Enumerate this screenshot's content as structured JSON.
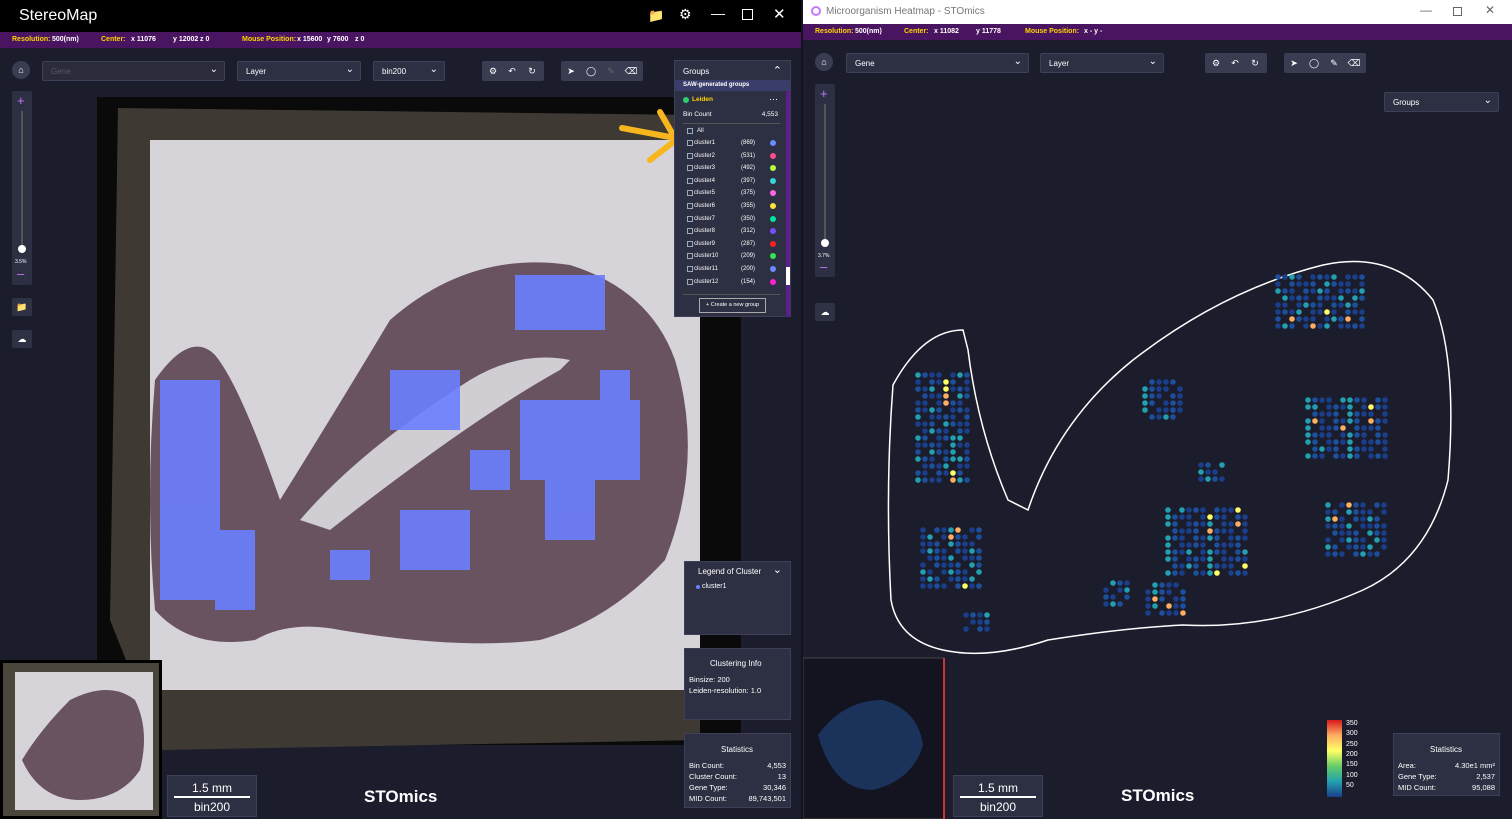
{
  "left": {
    "title": "StereoMap",
    "info": {
      "res_label": "Resolution:",
      "res_val": "500(nm)",
      "center_label": "Center:",
      "cx": "x  11076",
      "cy": "y  12002",
      "cz": "z  0",
      "mouse_label": "Mouse Position:",
      "mx": "x  15600",
      "my": "y  7600",
      "mz": "z  0"
    },
    "gene_placeholder": "Gene",
    "layer": "Layer",
    "bin": "bin200",
    "zoom": "3.5%",
    "groups": {
      "title": "Groups",
      "sub": "SAW-generated groups",
      "leiden": "Leiden",
      "bincount_label": "Bin Count",
      "bincount": "4,553",
      "all": "All",
      "create": "+  Create a new group",
      "clusters": [
        {
          "n": "cluster1",
          "c": "(869)",
          "col": "#6b8cff"
        },
        {
          "n": "cluster2",
          "c": "(531)",
          "col": "#ff4d8a"
        },
        {
          "n": "cluster3",
          "c": "(492)",
          "col": "#b4ff3a"
        },
        {
          "n": "cluster4",
          "c": "(397)",
          "col": "#33d6d6"
        },
        {
          "n": "cluster5",
          "c": "(375)",
          "col": "#ff66e0"
        },
        {
          "n": "cluster6",
          "c": "(355)",
          "col": "#ffe23a"
        },
        {
          "n": "cluster7",
          "c": "(350)",
          "col": "#00e6a0"
        },
        {
          "n": "cluster8",
          "c": "(312)",
          "col": "#7a4dff"
        },
        {
          "n": "cluster9",
          "c": "(287)",
          "col": "#ff2222"
        },
        {
          "n": "cluster10",
          "c": "(209)",
          "col": "#33e64d"
        },
        {
          "n": "cluster11",
          "c": "(200)",
          "col": "#6b8cff"
        },
        {
          "n": "cluster12",
          "c": "(154)",
          "col": "#ff22cc"
        }
      ]
    },
    "legend": {
      "title": "Legend of Cluster",
      "item": "cluster1"
    },
    "clustering": {
      "title": "Clustering Info",
      "binsize": "Binsize: 200",
      "leiden": "Leiden-resolution: 1.0"
    },
    "stats": {
      "title": "Statistics",
      "rows": [
        [
          "Bin Count:",
          "4,553"
        ],
        [
          "Cluster Count:",
          "13"
        ],
        [
          "Gene Type:",
          "30,346"
        ],
        [
          "MID Count:",
          "89,743,501"
        ]
      ]
    },
    "scale_top": "1.5 mm",
    "scale_bot": "bin200",
    "logo": "STOmics"
  },
  "right": {
    "title": "Microorganism Heatmap - STOmics",
    "info": {
      "res_label": "Resolution:",
      "res_val": "500(nm)",
      "center_label": "Center:",
      "cx": "x  11082",
      "cy": "y  11778",
      "mouse_label": "Mouse Position:",
      "m": "x -  y -"
    },
    "gene": "Gene",
    "layer": "Layer",
    "groups": "Groups",
    "zoom": "3.7%",
    "colorbar": [
      "350",
      "300",
      "250",
      "200",
      "150",
      "100",
      "50"
    ],
    "stats": {
      "title": "Statistics",
      "rows": [
        [
          "Area:",
          "4.30e1 mm²"
        ],
        [
          "Gene Type:",
          "2,537"
        ],
        [
          "MID Count:",
          "95,088"
        ]
      ]
    },
    "scale_top": "1.5 mm",
    "scale_bot": "bin200",
    "logo": "STOmics"
  }
}
